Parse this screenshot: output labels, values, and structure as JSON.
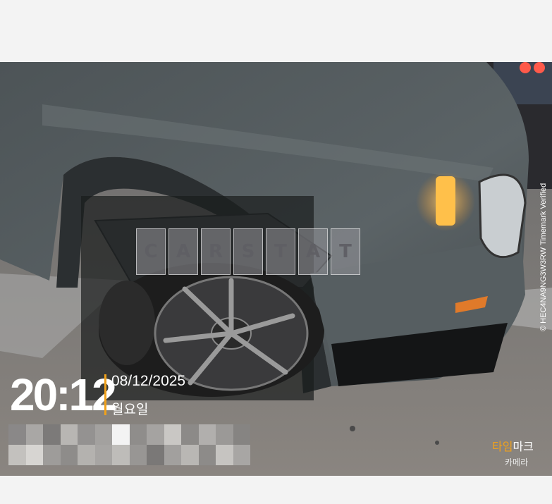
{
  "watermark": {
    "letters": [
      "C",
      "A",
      "R",
      "S",
      "T",
      "A",
      "T"
    ]
  },
  "timestamp": {
    "time": "20:12",
    "date": "08/12/2025",
    "weekday": "월요일"
  },
  "verification": {
    "text": "© HEC4NA9NG3W3RW  Timemark Verified"
  },
  "brand": {
    "part1": "타임",
    "part2": "마크",
    "sub": "카메라"
  },
  "colors": {
    "accent": "#f0a11b",
    "background": "#f3f3f3"
  }
}
